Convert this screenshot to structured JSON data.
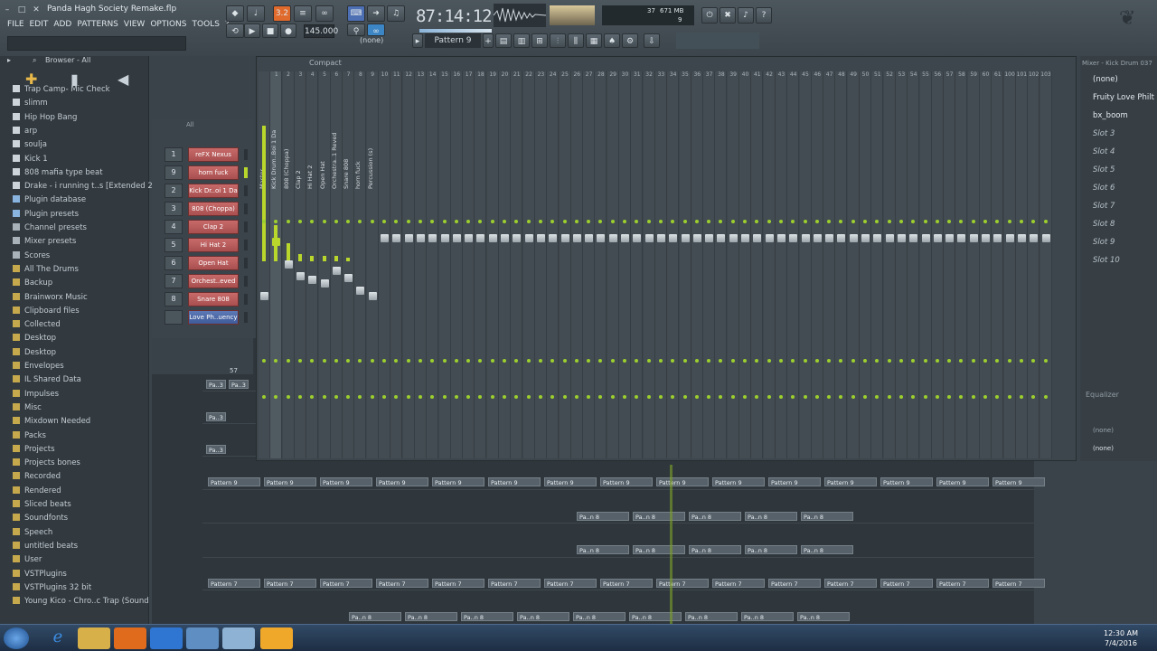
{
  "window": {
    "title": "Panda Hagh Society Remake.flp"
  },
  "menu": [
    "FILE",
    "EDIT",
    "ADD",
    "PATTERNS",
    "VIEW",
    "OPTIONS",
    "TOOLS",
    "?"
  ],
  "transport": {
    "time": "87:14:12",
    "tempo": "145.000",
    "pattern": "Pattern 9",
    "snap": "(none)",
    "cpu": "37",
    "memory": "671 MB",
    "voices": "9"
  },
  "browser": {
    "title": "Browser - All",
    "items": [
      {
        "label": "Trap Camp- Mic Check",
        "kind": "file"
      },
      {
        "label": "slimm",
        "kind": "file"
      },
      {
        "label": "Hip Hop Bang",
        "kind": "file"
      },
      {
        "label": "arp",
        "kind": "file"
      },
      {
        "label": "soulja",
        "kind": "file"
      },
      {
        "label": "Kick 1",
        "kind": "file"
      },
      {
        "label": "808 mafia type beat",
        "kind": "file"
      },
      {
        "label": "Drake - i running t..s [Extended 2 mins]",
        "kind": "file"
      },
      {
        "label": "Plugin database",
        "kind": "plugin"
      },
      {
        "label": "Plugin presets",
        "kind": "plugin"
      },
      {
        "label": "Channel presets",
        "kind": "preset"
      },
      {
        "label": "Mixer presets",
        "kind": "preset"
      },
      {
        "label": "Scores",
        "kind": "preset"
      },
      {
        "label": "All The Drums",
        "kind": "folder"
      },
      {
        "label": "Backup",
        "kind": "folder"
      },
      {
        "label": "Brainworx Music",
        "kind": "folder"
      },
      {
        "label": "Clipboard files",
        "kind": "folder"
      },
      {
        "label": "Collected",
        "kind": "folder"
      },
      {
        "label": "Desktop",
        "kind": "folder"
      },
      {
        "label": "Desktop",
        "kind": "folder"
      },
      {
        "label": "Envelopes",
        "kind": "folder"
      },
      {
        "label": "IL Shared Data",
        "kind": "folder"
      },
      {
        "label": "Impulses",
        "kind": "folder"
      },
      {
        "label": "Misc",
        "kind": "folder"
      },
      {
        "label": "Mixdown Needed",
        "kind": "folder"
      },
      {
        "label": "Packs",
        "kind": "folder"
      },
      {
        "label": "Projects",
        "kind": "folder"
      },
      {
        "label": "Projects bones",
        "kind": "folder"
      },
      {
        "label": "Recorded",
        "kind": "folder"
      },
      {
        "label": "Rendered",
        "kind": "folder"
      },
      {
        "label": "Sliced beats",
        "kind": "folder"
      },
      {
        "label": "Soundfonts",
        "kind": "folder"
      },
      {
        "label": "Speech",
        "kind": "folder"
      },
      {
        "label": "untitled beats",
        "kind": "folder"
      },
      {
        "label": "User",
        "kind": "folder"
      },
      {
        "label": "VSTPlugins",
        "kind": "folder"
      },
      {
        "label": "VSTPlugins 32 bit",
        "kind": "folder"
      },
      {
        "label": "Young Kico - Chro..c Trap (Sound Kit)",
        "kind": "folder"
      }
    ]
  },
  "rack": {
    "filter": "All",
    "channels": [
      {
        "num": "1",
        "name": "reFX Nexus",
        "color": "red"
      },
      {
        "num": "9",
        "name": "horn fuck",
        "color": "red"
      },
      {
        "num": "2",
        "name": "Kick Dr..oi 1 Da",
        "color": "red"
      },
      {
        "num": "3",
        "name": "808 (Choppa)",
        "color": "red"
      },
      {
        "num": "4",
        "name": "Clap 2",
        "color": "red"
      },
      {
        "num": "5",
        "name": "Hi Hat 2",
        "color": "red"
      },
      {
        "num": "6",
        "name": "Open Hat",
        "color": "red"
      },
      {
        "num": "7",
        "name": "Orchest..eved",
        "color": "red"
      },
      {
        "num": "8",
        "name": "Snare 808",
        "color": "red"
      },
      {
        "num": "",
        "name": "Love Ph..uency",
        "color": "blue"
      }
    ]
  },
  "mixer": {
    "title": "Mixer - Kick Drum 037",
    "view": "Compact",
    "tracks": [
      "Master",
      "Kick Drum..Boi 1 Da",
      "808 (Choppa)",
      "Clap 2",
      "Hi Hat 2",
      "Open Hat",
      "Orchestra..1 Reved",
      "Snare 808",
      "horn fuck",
      "Percussion (s)"
    ],
    "insert_numbers": [
      "1",
      "2",
      "3",
      "4",
      "5",
      "6",
      "7",
      "8",
      "9",
      "10",
      "11",
      "12",
      "13",
      "14",
      "15",
      "16",
      "17",
      "18",
      "19",
      "20",
      "21",
      "22",
      "23",
      "24",
      "25",
      "26",
      "27",
      "28",
      "29",
      "30",
      "31",
      "32",
      "33",
      "34",
      "35",
      "36",
      "37",
      "38",
      "39",
      "40",
      "41",
      "42",
      "43",
      "44",
      "45",
      "46",
      "47",
      "48",
      "49",
      "50",
      "51",
      "52",
      "53",
      "54",
      "55",
      "56",
      "57",
      "58",
      "59",
      "60",
      "61",
      "100",
      "101",
      "102",
      "103"
    ],
    "slots": [
      {
        "label": "(none)",
        "filled": true
      },
      {
        "label": "Fruity Love Philt",
        "filled": true
      },
      {
        "label": "bx_boom",
        "filled": true
      },
      {
        "label": "Slot 3",
        "filled": false
      },
      {
        "label": "Slot 4",
        "filled": false
      },
      {
        "label": "Slot 5",
        "filled": false
      },
      {
        "label": "Slot 6",
        "filled": false
      },
      {
        "label": "Slot 7",
        "filled": false
      },
      {
        "label": "Slot 8",
        "filled": false
      },
      {
        "label": "Slot 9",
        "filled": false
      },
      {
        "label": "Slot 10",
        "filled": false
      }
    ],
    "eq_label": "Equalizer",
    "out_label": "(none)",
    "out_label2": "(none)"
  },
  "playlist": {
    "bar_marker": "57",
    "clip_pattern9": "Pattern 9",
    "clip_pattern7": "Pattern 7",
    "clip_short": "Pa..3",
    "clip_short2": "Pa..n 8"
  },
  "taskbar": {
    "time": "12:30 AM",
    "date": "7/4/2016"
  },
  "colors": {
    "accent": "#b8d62c",
    "red_channel": "#c86a6a",
    "blue_channel": "#5c78b5",
    "taskbar": "#1d2e44"
  }
}
